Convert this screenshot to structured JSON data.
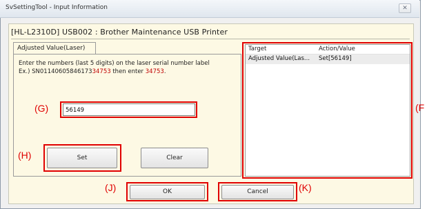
{
  "window": {
    "title": "SvSettingTool - Input Information",
    "close_glyph": "✕"
  },
  "header": "[HL-L2310D] USB002 : Brother Maintenance USB Printer",
  "tab": {
    "label": "Adjusted Value(Laser)"
  },
  "instructions": {
    "line1": "Enter the numbers (last 5 digits) on the laser serial number label",
    "example_prefix": "Ex.) SN01140605846173",
    "example_highlight": "34753",
    "example_middle": " then enter ",
    "example_value": "34753",
    "example_end": "."
  },
  "serial_input": {
    "value": "56149"
  },
  "buttons": {
    "set": "Set",
    "clear": "Clear",
    "ok": "OK",
    "cancel": "Cancel"
  },
  "table": {
    "columns": [
      "Target",
      "Action/Value"
    ],
    "rows": [
      {
        "target": "Adjusted Value(Las...",
        "action": "Set[56149]"
      }
    ]
  },
  "callouts": {
    "g": "(G)",
    "h": "(H)",
    "j": "(J)",
    "k": "(K)",
    "f": "(F"
  },
  "colors": {
    "callout_red": "#e00000",
    "highlight_red": "#c00000",
    "panel_bg": "#fdf9e4"
  }
}
